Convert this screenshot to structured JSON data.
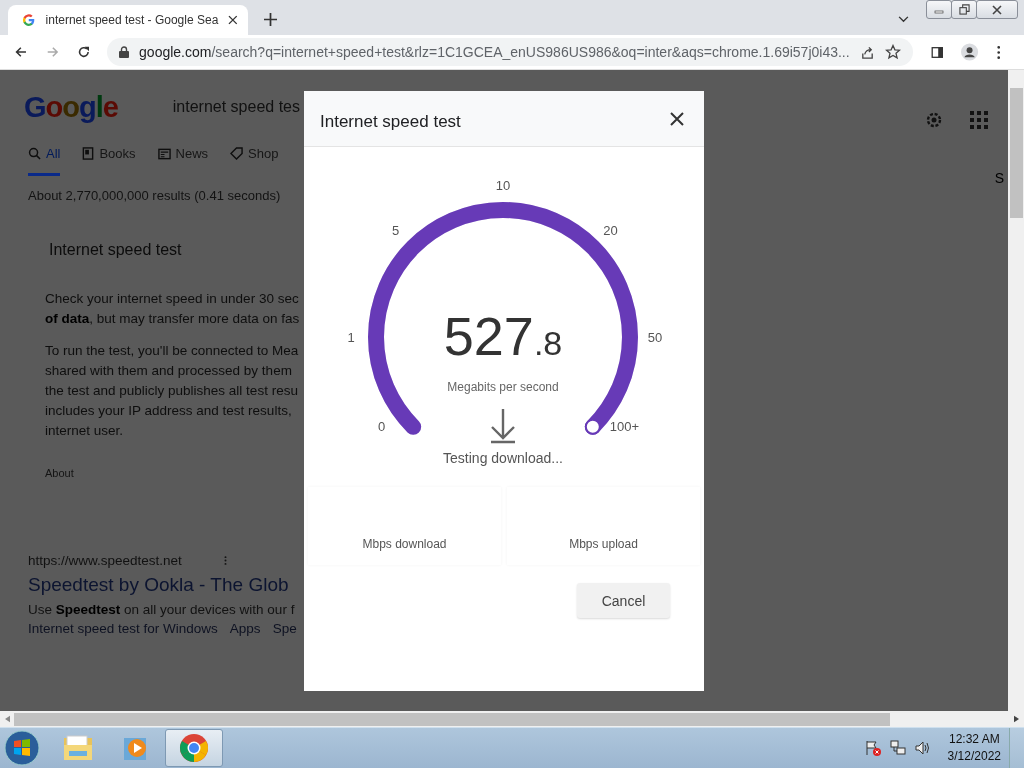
{
  "browser": {
    "tab_title": "internet speed test - Google Sea",
    "url_host": "google.com",
    "url_rest": "/search?q=internet+speed+test&rlz=1C1GCEA_enUS986US986&oq=inter&aqs=chrome.1.69i57j0i43..."
  },
  "page": {
    "logo": "Google",
    "search_query": "internet speed tes",
    "nav_tabs": [
      {
        "label": "All",
        "kind": "search",
        "selected": true
      },
      {
        "label": "Books",
        "kind": "book",
        "selected": false
      },
      {
        "label": "News",
        "kind": "news",
        "selected": false
      },
      {
        "label": "Shop",
        "kind": "tag",
        "selected": false
      }
    ],
    "edge_text": "S",
    "results_count": "About 2,770,000,000 results (0.41 seconds)",
    "card": {
      "title": "Internet speed test",
      "paragraphs": [
        [
          "Check your internet speed in under 30 sec",
          "**of data**, but may transfer more data on fas"
        ],
        [
          "To run the test, you'll be connected to Mea",
          "shared with them and processed by them",
          "the test and publicly publishes all test resu",
          "includes your IP address and test results,",
          "internet user."
        ]
      ],
      "about": "About"
    },
    "result": {
      "url": "https://www.speedtest.net",
      "title": "Speedtest by Ookla - The Glob",
      "snippet": "Use **Speedtest** on all your devices with our f",
      "sitelinks": [
        "Internet speed test for Windows",
        "Apps",
        "Spe"
      ]
    }
  },
  "dialog": {
    "title": "Internet speed test",
    "ticks": [
      "0",
      "1",
      "5",
      "10",
      "20",
      "50",
      "100+"
    ],
    "level": 1,
    "speed_whole": "527",
    "speed_fraction": ".8",
    "unit": "Megabits per second",
    "status": "Testing download...",
    "stats": [
      "Mbps download",
      "Mbps upload"
    ],
    "cancel": "Cancel"
  },
  "taskbar": {
    "apps": [
      {
        "kind": "explorer",
        "selected": false
      },
      {
        "kind": "media",
        "selected": false
      },
      {
        "kind": "chrome",
        "selected": true
      }
    ],
    "time": "12:32 AM",
    "date": "3/12/2022"
  }
}
